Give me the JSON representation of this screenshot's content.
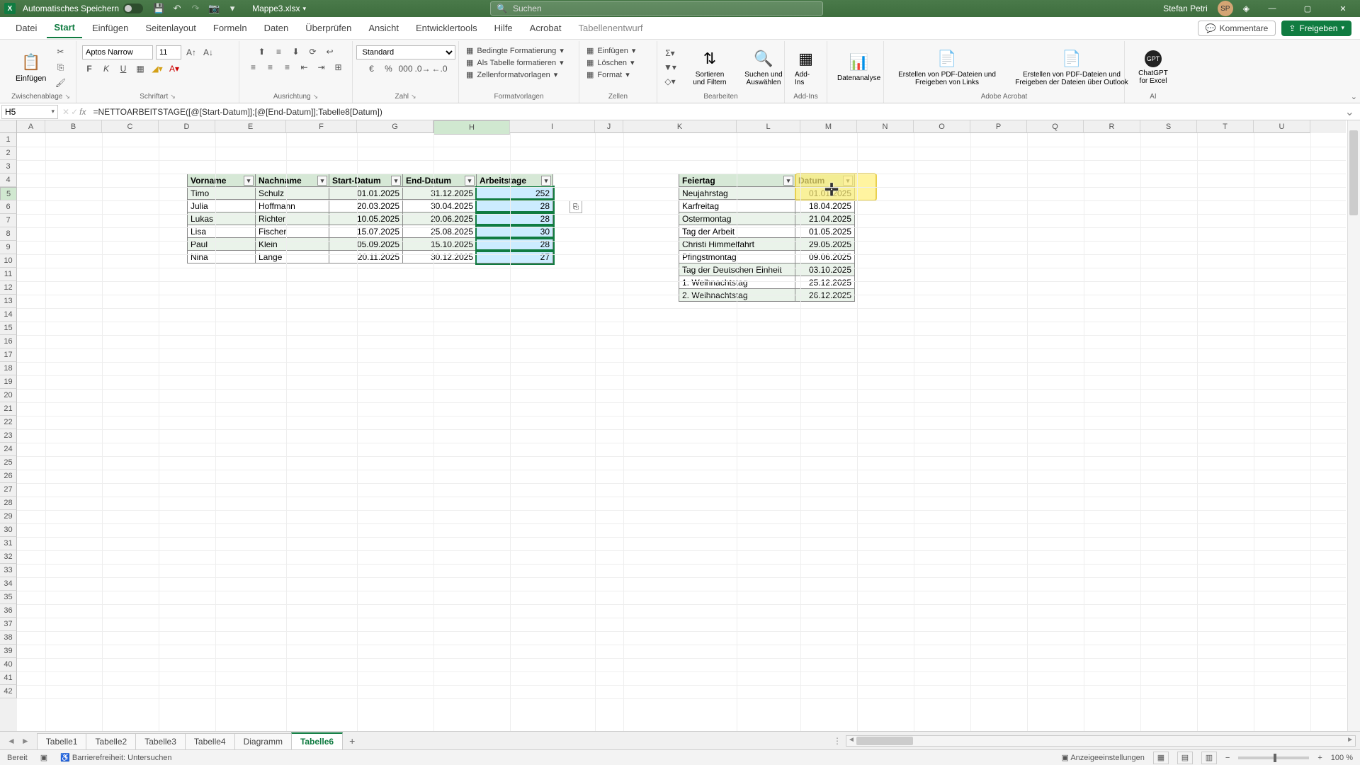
{
  "titlebar": {
    "autosave_label": "Automatisches Speichern",
    "filename": "Mappe3.xlsx",
    "search_placeholder": "Suchen",
    "username": "Stefan Petri"
  },
  "menutabs": {
    "items": [
      "Datei",
      "Start",
      "Einfügen",
      "Seitenlayout",
      "Formeln",
      "Daten",
      "Überprüfen",
      "Ansicht",
      "Entwicklertools",
      "Hilfe",
      "Acrobat",
      "Tabellenentwurf"
    ],
    "active": "Start",
    "comments": "Kommentare",
    "share": "Freigeben"
  },
  "ribbon": {
    "clip": {
      "paste": "Einfügen",
      "group": "Zwischenablage"
    },
    "font": {
      "name": "Aptos Narrow",
      "size": "11",
      "group": "Schriftart"
    },
    "align": {
      "group": "Ausrichtung"
    },
    "number": {
      "format": "Standard",
      "group": "Zahl"
    },
    "styles": {
      "cond": "Bedingte Formatierung",
      "astable": "Als Tabelle formatieren",
      "cell": "Zellenformatvorlagen",
      "group": "Formatvorlagen"
    },
    "cells": {
      "insert": "Einfügen",
      "delete": "Löschen",
      "format": "Format",
      "group": "Zellen"
    },
    "edit": {
      "sort": "Sortieren und Filtern",
      "find": "Suchen und Auswählen",
      "group": "Bearbeiten"
    },
    "addins": {
      "btn": "Add-Ins",
      "group": "Add-Ins"
    },
    "data": {
      "btn": "Datenanalyse"
    },
    "acrobat": {
      "b1": "Erstellen von PDF-Dateien und Freigeben von Links",
      "b2": "Erstellen von PDF-Dateien und Freigeben der Dateien über Outlook",
      "group": "Adobe Acrobat"
    },
    "ai": {
      "btn": "ChatGPT for Excel",
      "group": "AI"
    }
  },
  "formula": {
    "cellref": "H5",
    "formula": "=NETTOARBEITSTAGE([@[Start-Datum]];[@[End-Datum]];Tabelle8[Datum])"
  },
  "columns": [
    "A",
    "B",
    "C",
    "D",
    "E",
    "F",
    "G",
    "H",
    "I",
    "J",
    "K",
    "L",
    "M",
    "N",
    "O",
    "P",
    "Q",
    "R",
    "S",
    "T",
    "U"
  ],
  "table1": {
    "headers": [
      "Vorname",
      "Nachname",
      "Start-Datum",
      "End-Datum",
      "Arbeitstage"
    ],
    "rows": [
      [
        "Timo",
        "Schulz",
        "01.01.2025",
        "31.12.2025",
        "252"
      ],
      [
        "Julia",
        "Hoffmann",
        "20.03.2025",
        "30.04.2025",
        "28"
      ],
      [
        "Lukas",
        "Richter",
        "10.05.2025",
        "20.06.2025",
        "28"
      ],
      [
        "Lisa",
        "Fischer",
        "15.07.2025",
        "25.08.2025",
        "30"
      ],
      [
        "Paul",
        "Klein",
        "05.09.2025",
        "15.10.2025",
        "28"
      ],
      [
        "Nina",
        "Lange",
        "20.11.2025",
        "30.12.2025",
        "27"
      ]
    ]
  },
  "table2": {
    "headers": [
      "Feiertag",
      "Datum"
    ],
    "rows": [
      [
        "Neujahrstag",
        "01.01.2025"
      ],
      [
        "Karfreitag",
        "18.04.2025"
      ],
      [
        "Ostermontag",
        "21.04.2025"
      ],
      [
        "Tag der Arbeit",
        "01.05.2025"
      ],
      [
        "Christi Himmelfahrt",
        "29.05.2025"
      ],
      [
        "Pfingstmontag",
        "09.06.2025"
      ],
      [
        "Tag der Deutschen Einheit",
        "03.10.2025"
      ],
      [
        "1. Weihnachtstag",
        "25.12.2025"
      ],
      [
        "2. Weihnachtstag",
        "26.12.2025"
      ]
    ]
  },
  "sheets": {
    "tabs": [
      "Tabelle1",
      "Tabelle2",
      "Tabelle3",
      "Tabelle4",
      "Diagramm",
      "Tabelle6"
    ],
    "active": "Tabelle6"
  },
  "status": {
    "ready": "Bereit",
    "access": "Barrierefreiheit: Untersuchen",
    "display": "Anzeigeeinstellungen",
    "zoom": "100 %"
  }
}
